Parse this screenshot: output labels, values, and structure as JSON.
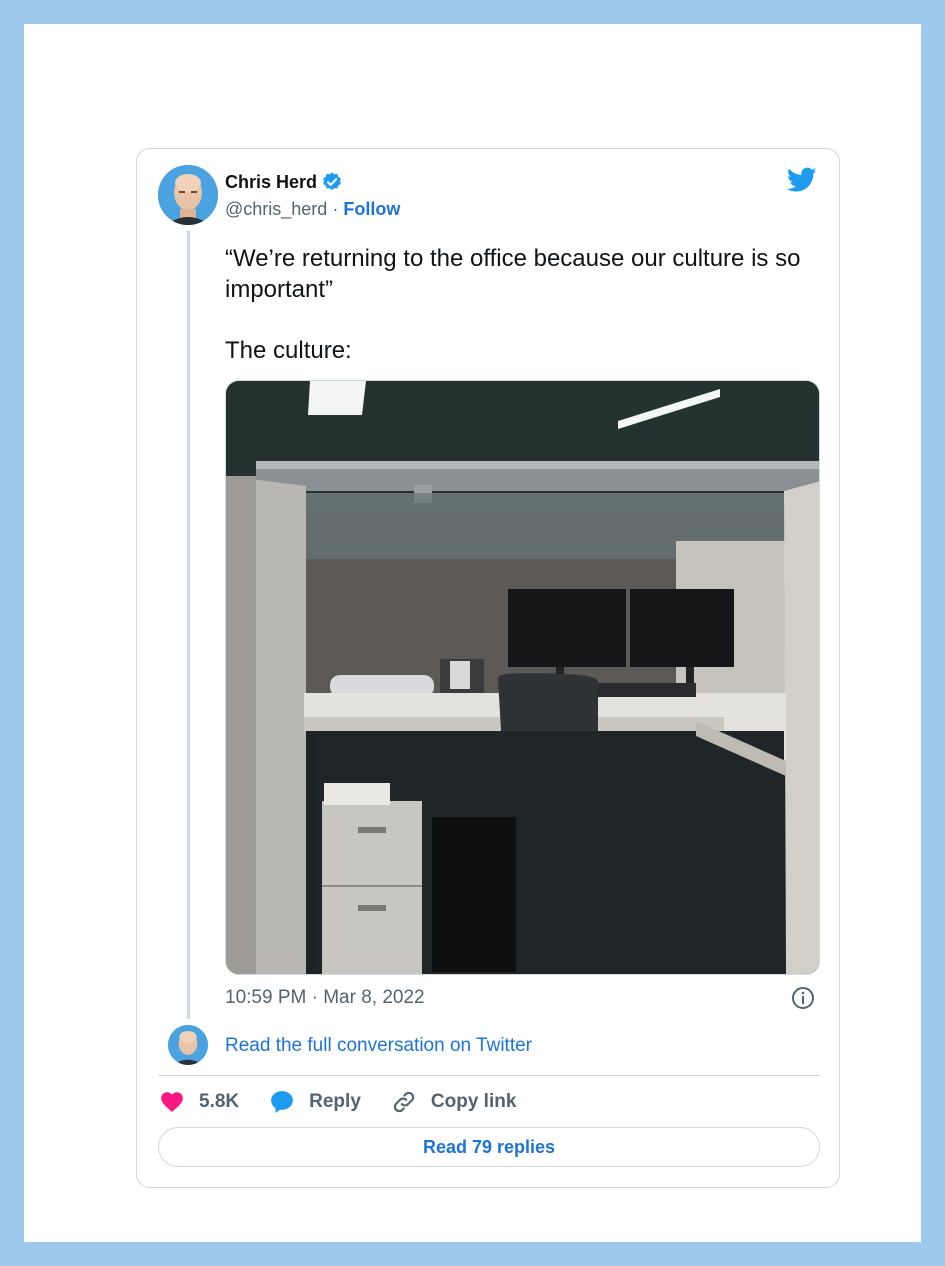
{
  "tweet": {
    "author_name": "Chris Herd",
    "handle": "@chris_herd",
    "separator": "·",
    "follow_label": "Follow",
    "text_line1": "“We’re returning to the office because our culture is so important”",
    "text_line2": "The culture:",
    "timestamp": "10:59 PM · Mar 8, 2022",
    "read_conversation": "Read the full conversation on Twitter",
    "likes_count": "5.8K",
    "reply_label": "Reply",
    "copy_link_label": "Copy link",
    "read_replies_label": "Read 79 replies"
  },
  "colors": {
    "background": "#9ec9ea",
    "link_blue": "#1d74d8",
    "twitter_blue": "#1d9bf0",
    "like_pink": "#f91880",
    "text_primary": "#0f1419",
    "text_secondary": "#536471"
  },
  "icons": [
    "verified-badge-icon",
    "twitter-bird-icon",
    "info-icon",
    "heart-icon",
    "reply-bubble-icon",
    "link-icon"
  ]
}
